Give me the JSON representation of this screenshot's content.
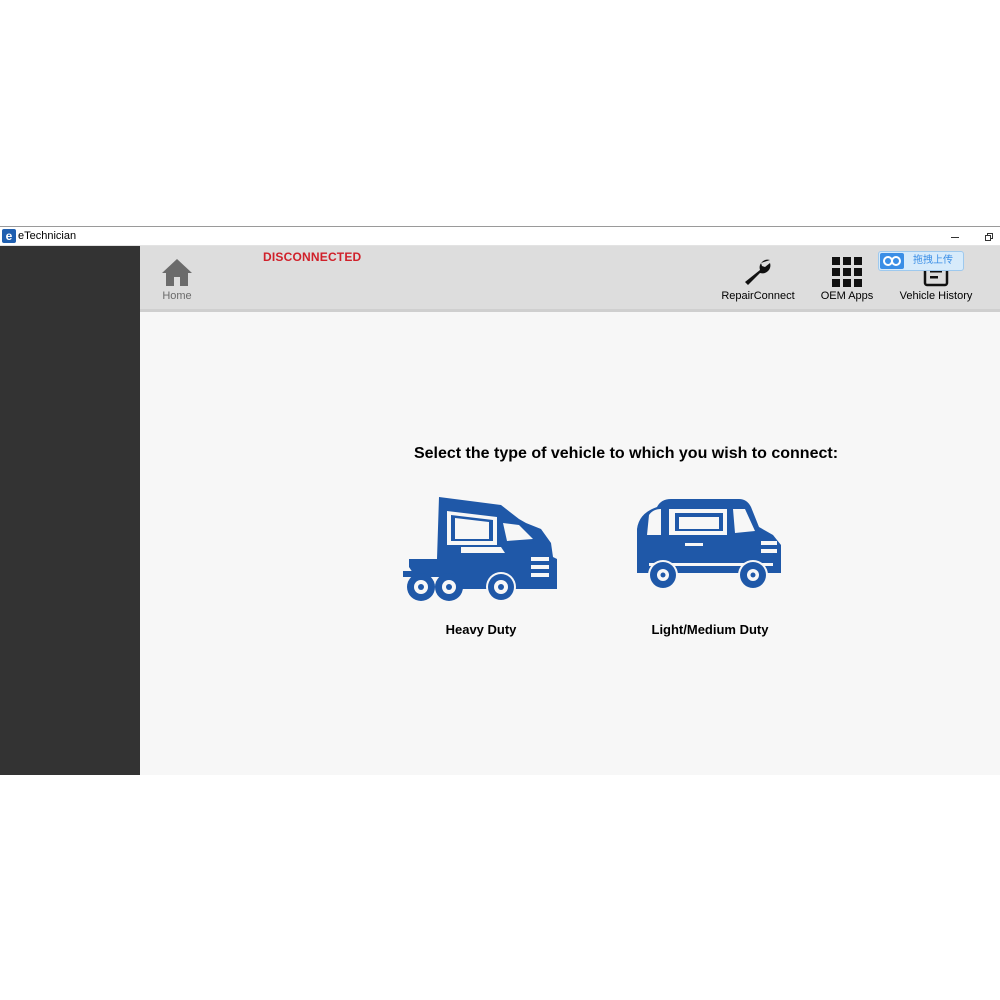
{
  "window": {
    "app_title": "eTechnician",
    "app_icon_letter": "e"
  },
  "toolbar": {
    "home_label": "Home",
    "connection_status": "DISCONNECTED",
    "repairconnect_label": "RepairConnect",
    "oem_apps_label": "OEM Apps",
    "vehicle_history_label": "Vehicle History"
  },
  "overlay": {
    "label": "拖拽上传"
  },
  "main": {
    "prompt": "Select the type of vehicle to which you wish to connect:",
    "vehicles": [
      {
        "label": "Heavy Duty",
        "icon": "semi-truck-icon"
      },
      {
        "label": "Light/Medium Duty",
        "icon": "van-icon"
      }
    ]
  },
  "colors": {
    "accent_blue": "#1f58a8",
    "status_red": "#d0202a",
    "sidebar": "#333333",
    "toolbar": "#dddddd"
  }
}
